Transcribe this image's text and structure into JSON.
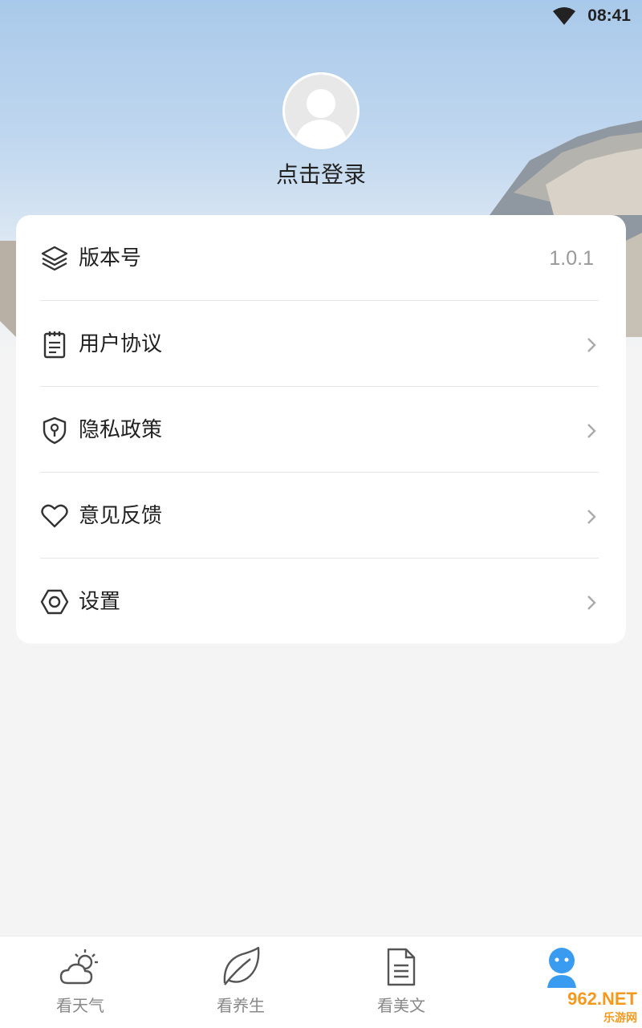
{
  "status_bar": {
    "time": "08:41"
  },
  "profile": {
    "login_label": "点击登录"
  },
  "menu": {
    "items": [
      {
        "label": "版本号",
        "value": "1.0.1"
      },
      {
        "label": "用户协议"
      },
      {
        "label": "隐私政策"
      },
      {
        "label": "意见反馈"
      },
      {
        "label": "设置"
      }
    ]
  },
  "tabs": [
    {
      "label": "看天气",
      "active": false
    },
    {
      "label": "看养生",
      "active": false
    },
    {
      "label": "看美文",
      "active": false
    },
    {
      "label": "",
      "active": true
    }
  ],
  "watermark": {
    "text": "962.NET",
    "sub": "乐游网"
  },
  "colors": {
    "accent": "#3a9cf0",
    "text": "#222222",
    "muted": "#999999"
  }
}
